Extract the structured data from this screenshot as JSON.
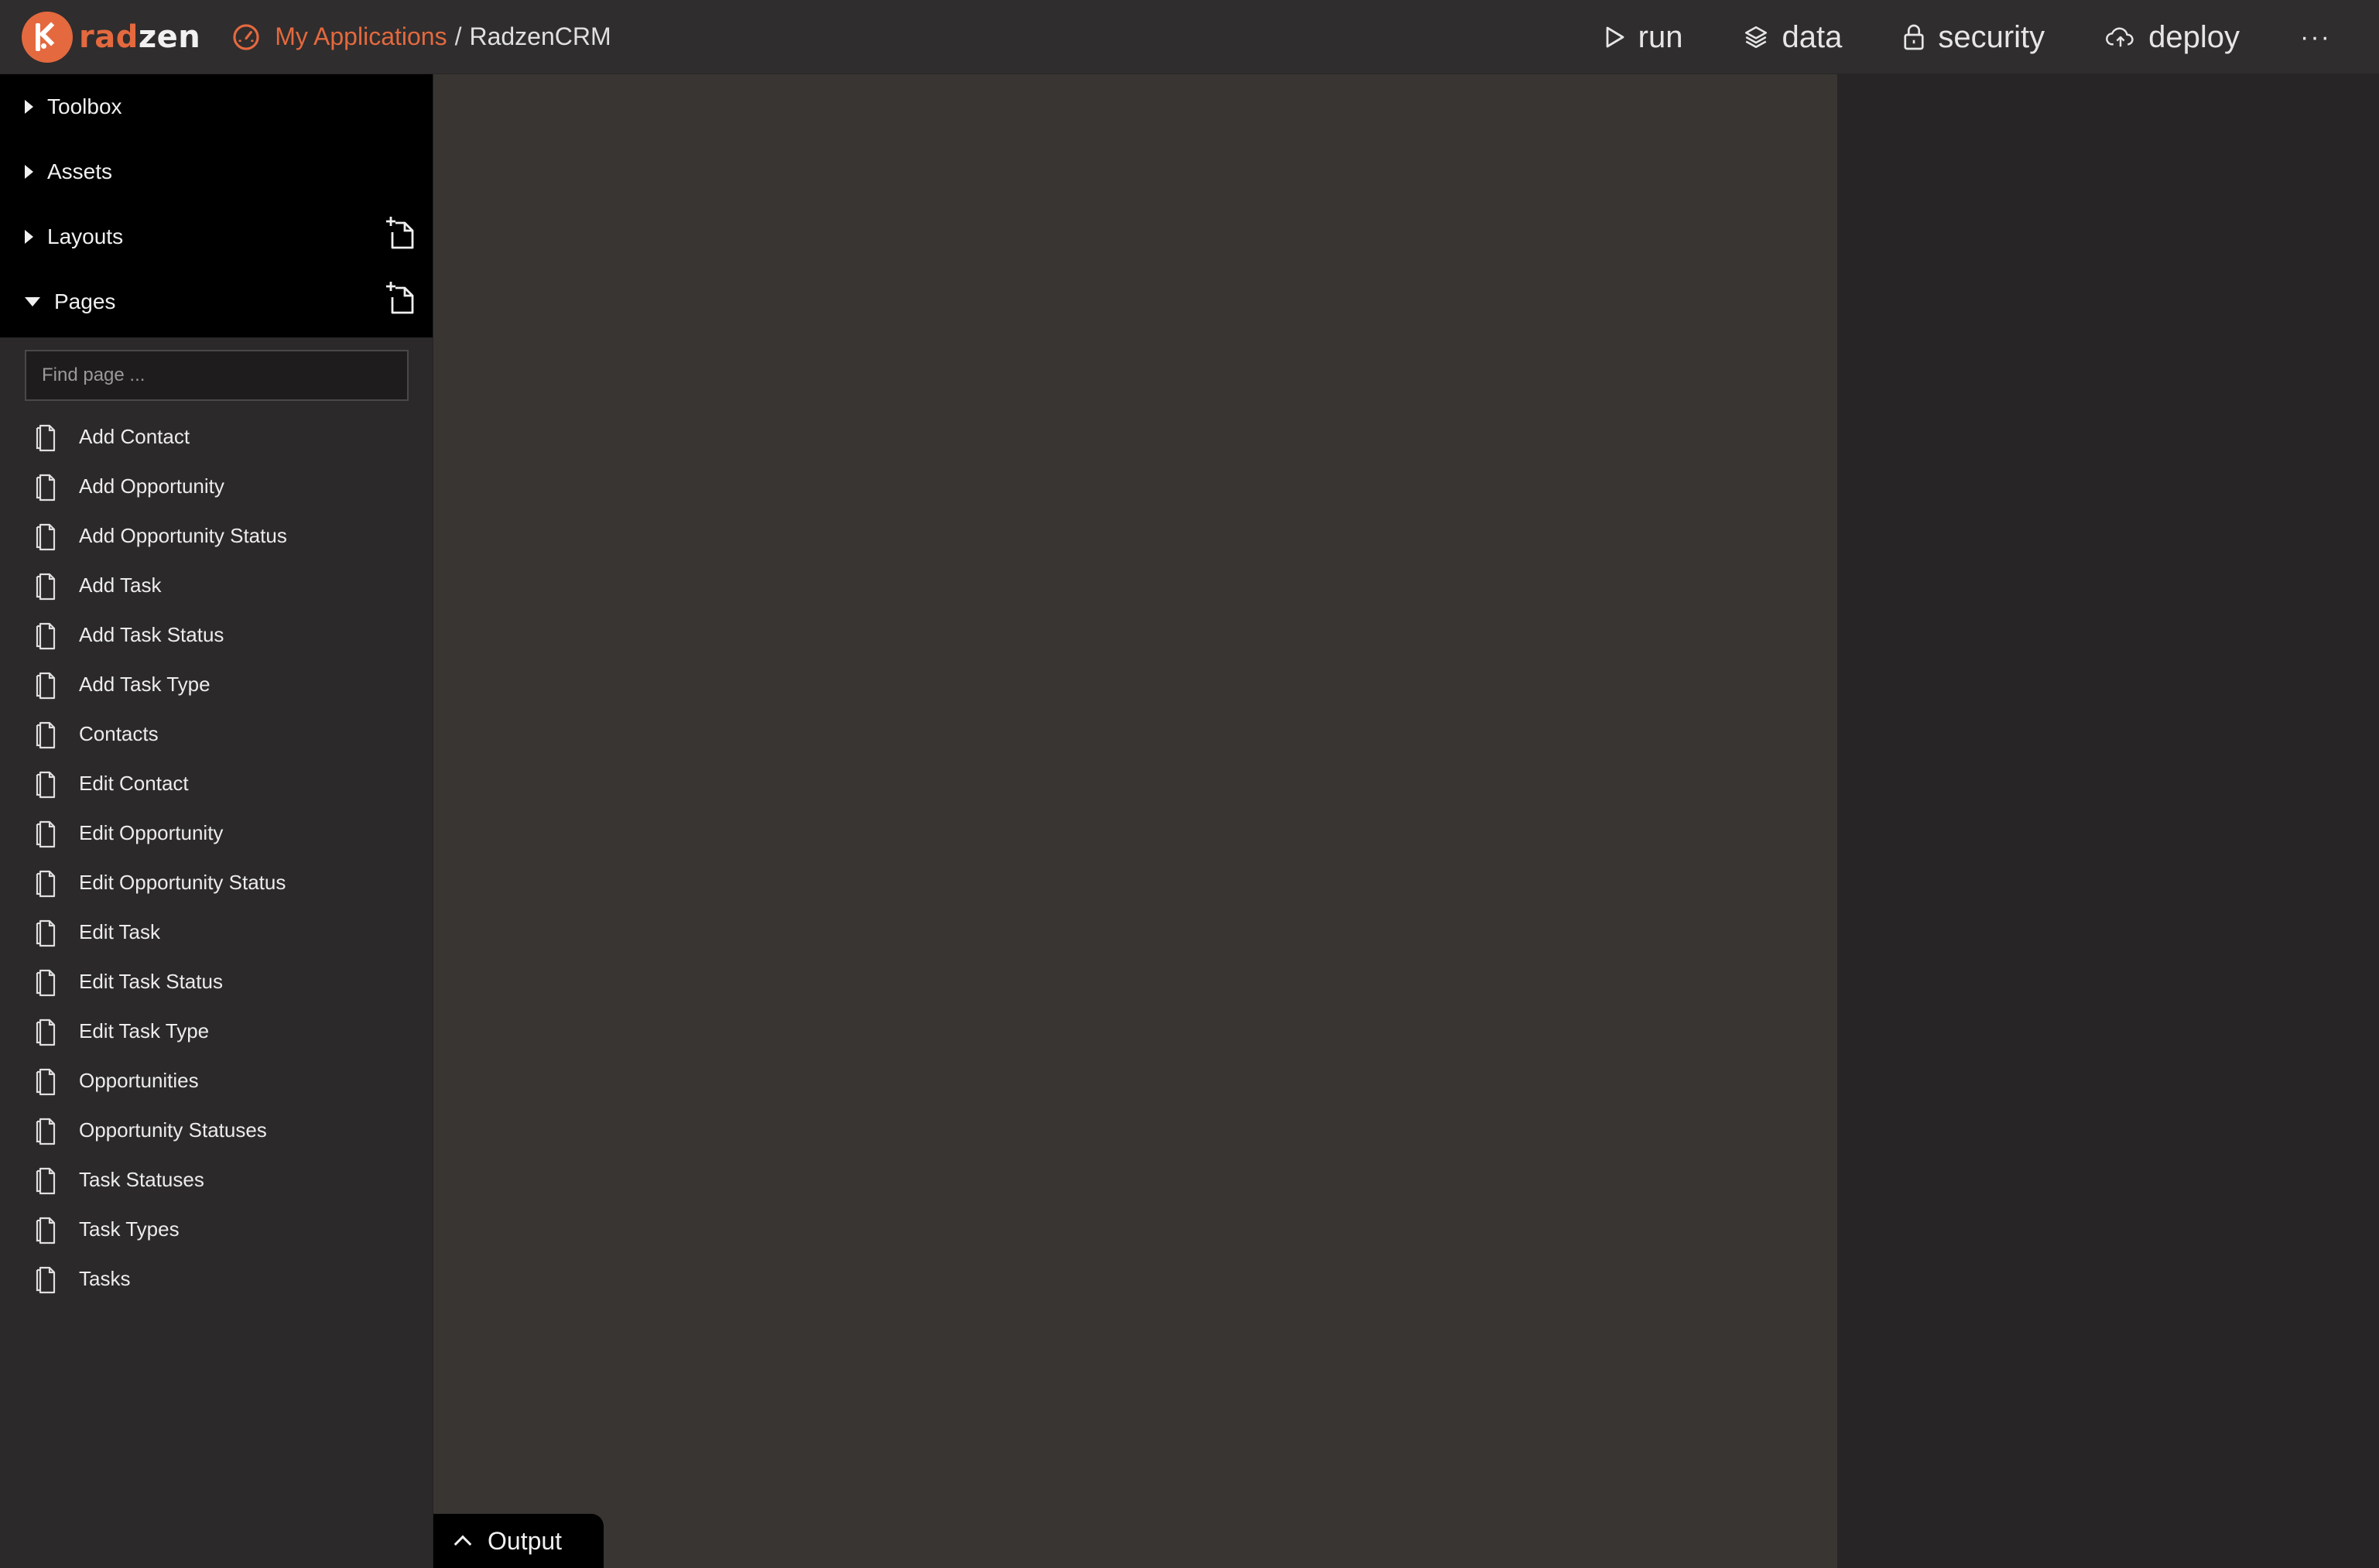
{
  "brand": {
    "name_accent": "rad",
    "name_rest": "zen"
  },
  "breadcrumb": {
    "link": "My Applications",
    "separator": "/",
    "current": "RadzenCRM"
  },
  "nav": {
    "run": "run",
    "data": "data",
    "security": "security",
    "deploy": "deploy",
    "more": "···"
  },
  "sidebar": {
    "sections": {
      "toolbox": "Toolbox",
      "assets": "Assets",
      "layouts": "Layouts",
      "pages": "Pages"
    },
    "search": {
      "placeholder": "Find page ..."
    },
    "pages": [
      "Add Contact",
      "Add Opportunity",
      "Add Opportunity Status",
      "Add Task",
      "Add Task Status",
      "Add Task Type",
      "Contacts",
      "Edit Contact",
      "Edit Opportunity",
      "Edit Opportunity Status",
      "Edit Task",
      "Edit Task Status",
      "Edit Task Type",
      "Opportunities",
      "Opportunity Statuses",
      "Task Statuses",
      "Task Types",
      "Tasks"
    ]
  },
  "output": {
    "label": "Output"
  },
  "colors": {
    "accent": "#e4693f",
    "topbar": "#2f2d2d",
    "canvas": "#393533",
    "sidebar": "#2b2929"
  }
}
